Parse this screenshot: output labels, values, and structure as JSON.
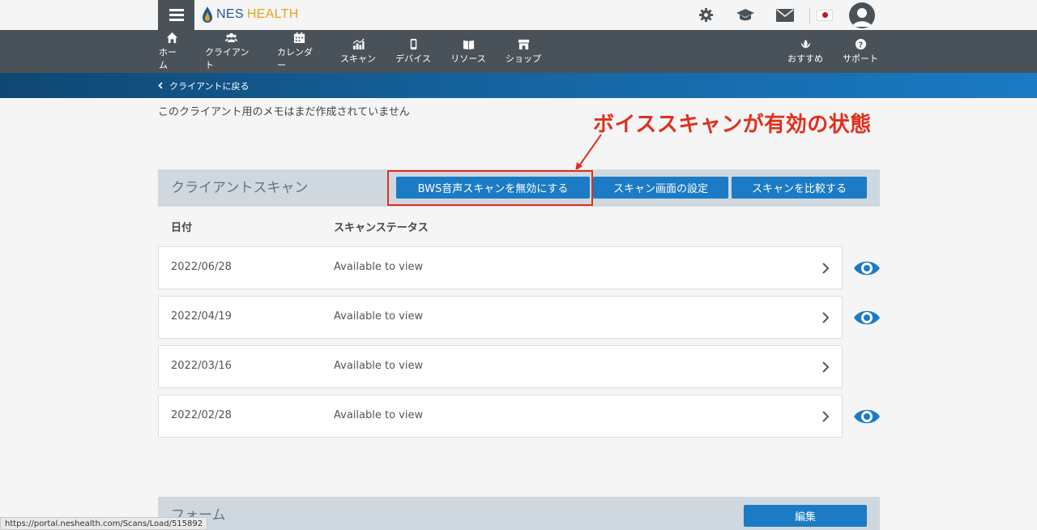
{
  "header": {
    "logo_nes": "NES",
    "logo_health": "HEALTH",
    "icons": [
      "gear-icon",
      "graduation-cap-icon",
      "mail-icon",
      "japan-flag-icon",
      "user-avatar-icon"
    ]
  },
  "nav": {
    "items": [
      {
        "label": "ホーム",
        "icon": "home-icon"
      },
      {
        "label": "クライアント",
        "icon": "users-icon"
      },
      {
        "label": "カレンダー",
        "icon": "calendar-icon"
      },
      {
        "label": "スキャン",
        "icon": "chart-icon"
      },
      {
        "label": "デバイス",
        "icon": "device-icon"
      },
      {
        "label": "リソース",
        "icon": "book-icon"
      },
      {
        "label": "ショップ",
        "icon": "shop-icon"
      }
    ],
    "right_items": [
      {
        "label": "おすすめ",
        "icon": "lotus-icon"
      },
      {
        "label": "サポート",
        "icon": "help-icon"
      }
    ]
  },
  "breadcrumb": {
    "back_label": "クライアントに戻る"
  },
  "notes": {
    "empty_text": "このクライアント用のメモはまだ作成されていません"
  },
  "annotation": {
    "text": "ボイススキャンが有効の状態"
  },
  "scans": {
    "title": "クライアントスキャン",
    "buttons": {
      "disable_bws": "BWS音声スキャンを無効にする",
      "screen_settings": "スキャン画面の設定",
      "compare": "スキャンを比較する"
    },
    "columns": {
      "date": "日付",
      "status": "スキャンステータス"
    },
    "rows": [
      {
        "date": "2022/06/28",
        "status": "Available to view",
        "has_eye": true
      },
      {
        "date": "2022/04/19",
        "status": "Available to view",
        "has_eye": true
      },
      {
        "date": "2022/03/16",
        "status": "Available to view",
        "has_eye": false
      },
      {
        "date": "2022/02/28",
        "status": "Available to view",
        "has_eye": true
      }
    ]
  },
  "forms": {
    "title": "フォーム",
    "edit_label": "編集"
  },
  "status_url": "https://portal.neshealth.com/Scans/Load/515892",
  "colors": {
    "nav_bg": "#4a5259",
    "accent": "#1b7bc4",
    "annotation": "#e0301e",
    "panel": "#cfd8df"
  }
}
